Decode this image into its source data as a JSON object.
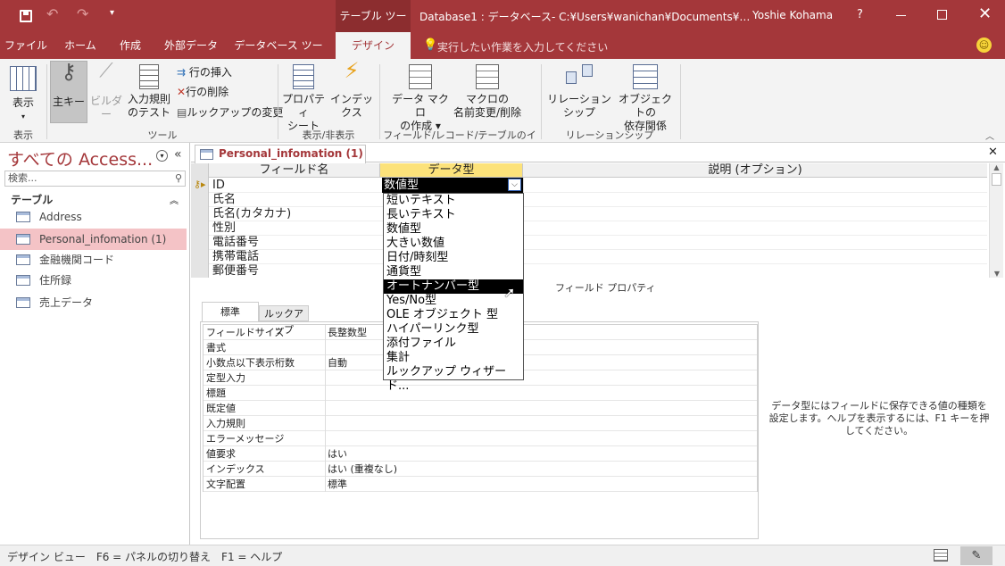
{
  "titlebar": {
    "context": "テーブル ツール",
    "title": "Database1 : データベース- C:¥Users¥wanichan¥Documents¥…",
    "user": "Yoshie Kohama",
    "help": "?"
  },
  "tabs": [
    "ファイル",
    "ホーム",
    "作成",
    "外部データ",
    "データベース ツール",
    "デザイン"
  ],
  "tell_me": "実行したい作業を入力してください",
  "ribbon": {
    "view": "表示",
    "view_group": "表示",
    "primary_key": "主キー",
    "builder": "ビルダー",
    "test_rules_1": "入力規則",
    "test_rules_2": "のテスト",
    "insert_rows": "行の挿入",
    "delete_rows": "行の削除",
    "modify_lookups": "ルックアップの変更",
    "tools_group": "ツール",
    "property_sheet_1": "プロパティ",
    "property_sheet_2": "シート",
    "indexes": "インデックス",
    "show_hide_group": "表示/非表示",
    "data_macro_1": "データ マクロ",
    "data_macro_2": "の作成",
    "rename_macro_1": "マクロの",
    "rename_macro_2": "名前変更/削除",
    "events_group": "フィールド/レコード/テーブルのイベント",
    "relationships": "リレーションシップ",
    "obj_dep_1": "オブジェクトの",
    "obj_dep_2": "依存関係",
    "rel_group": "リレーションシップ"
  },
  "nav": {
    "title": "すべての Access...",
    "search_placeholder": "検索...",
    "section": "テーブル",
    "items": [
      "Address",
      "Personal_infomation (1)",
      "金融機関コード",
      "住所録",
      "売上データ"
    ]
  },
  "doc": {
    "tab": "Personal_infomation (1)",
    "headers": {
      "field": "フィールド名",
      "type": "データ型",
      "desc": "説明 (オプション)"
    },
    "rows": [
      "ID",
      "氏名",
      "氏名(カタカナ)",
      "性別",
      "電話番号",
      "携帯電話",
      "郵便番号"
    ],
    "current_type": "数値型",
    "dropdown": [
      "短いテキスト",
      "長いテキスト",
      "数値型",
      "大きい数値",
      "日付/時刻型",
      "通貨型",
      "オートナンバー型",
      "Yes/No型",
      "OLE オブジェクト 型",
      "ハイパーリンク型",
      "添付ファイル",
      "集計",
      "ルックアップ ウィザード..."
    ],
    "dropdown_selected": "オートナンバー型",
    "field_props_label": "フィールド プロパティ",
    "prop_tabs": [
      "標準",
      "ルックアップ"
    ],
    "props": [
      {
        "k": "フィールドサイズ",
        "v": "長整数型"
      },
      {
        "k": "書式",
        "v": ""
      },
      {
        "k": "小数点以下表示桁数",
        "v": "自動"
      },
      {
        "k": "定型入力",
        "v": ""
      },
      {
        "k": "標題",
        "v": ""
      },
      {
        "k": "既定値",
        "v": ""
      },
      {
        "k": "入力規則",
        "v": ""
      },
      {
        "k": "エラーメッセージ",
        "v": ""
      },
      {
        "k": "値要求",
        "v": "はい"
      },
      {
        "k": "インデックス",
        "v": "はい (重複なし)"
      },
      {
        "k": "文字配置",
        "v": "標準"
      }
    ],
    "help": "データ型にはフィールドに保存できる値の種類を設定します。ヘルプを表示するには、F1 キーを押してください。"
  },
  "status": "デザイン ビュー　F6 = パネルの切り替え　F1 = ヘルプ"
}
